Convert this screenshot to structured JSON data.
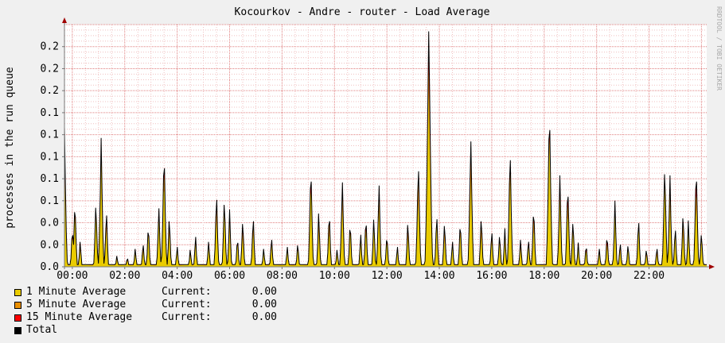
{
  "chart_data": {
    "type": "area",
    "title": "Kocourkov - Andre - router - Load Average",
    "ylabel": "processes in the run queue",
    "xlabel": "",
    "watermark": "RRDTOOL / TOBI OETIKER",
    "x_ticks": [
      "00:00",
      "02:00",
      "04:00",
      "06:00",
      "08:00",
      "10:00",
      "12:00",
      "14:00",
      "16:00",
      "18:00",
      "20:00",
      "22:00"
    ],
    "y_tick_labels": [
      "0.0",
      "0.0",
      "0.0",
      "0.1",
      "0.1",
      "0.1",
      "0.1",
      "0.1",
      "0.2",
      "0.2",
      "0.2"
    ],
    "y_tick_values": [
      0.0,
      0.02,
      0.04,
      0.06,
      0.08,
      0.1,
      0.12,
      0.14,
      0.16,
      0.18,
      0.2
    ],
    "ylim": [
      0,
      0.22
    ],
    "xlim_hours": [
      -0.3,
      24.2
    ],
    "grid": true,
    "colors": {
      "one": "#EACC00",
      "five": "#EA8F00",
      "fifteen": "#FF0000",
      "total": "#000000",
      "grid_minor": "#f0c0c0",
      "grid_major": "#e08080",
      "axis": "#777777",
      "arrow": "#a00000",
      "canvas": "#ffffff"
    },
    "series": [
      {
        "name": "1 Minute Average",
        "current": "0.00"
      },
      {
        "name": "5 Minute Average",
        "current": "0.00"
      },
      {
        "name": "15 Minute Average",
        "current": "0.00"
      },
      {
        "name": "Total"
      }
    ],
    "current_label": "Current:",
    "peaks": [
      [
        -0.3,
        0.127
      ],
      [
        0.0,
        0.039
      ],
      [
        0.1,
        0.065
      ],
      [
        0.3,
        0.025
      ],
      [
        0.9,
        0.064
      ],
      [
        1.1,
        0.117
      ],
      [
        1.3,
        0.056
      ],
      [
        1.7,
        0.011
      ],
      [
        2.1,
        0.01
      ],
      [
        2.4,
        0.018
      ],
      [
        2.7,
        0.024
      ],
      [
        2.9,
        0.042
      ],
      [
        3.3,
        0.058
      ],
      [
        3.5,
        0.112
      ],
      [
        3.7,
        0.05
      ],
      [
        4.0,
        0.02
      ],
      [
        4.5,
        0.017
      ],
      [
        4.7,
        0.03
      ],
      [
        5.2,
        0.025
      ],
      [
        5.5,
        0.072
      ],
      [
        5.8,
        0.067
      ],
      [
        6.0,
        0.052
      ],
      [
        6.3,
        0.03
      ],
      [
        6.5,
        0.047
      ],
      [
        6.9,
        0.05
      ],
      [
        7.3,
        0.018
      ],
      [
        7.6,
        0.03
      ],
      [
        8.2,
        0.02
      ],
      [
        8.6,
        0.024
      ],
      [
        9.1,
        0.098
      ],
      [
        9.4,
        0.053
      ],
      [
        9.8,
        0.055
      ],
      [
        10.1,
        0.017
      ],
      [
        10.3,
        0.083
      ],
      [
        10.6,
        0.045
      ],
      [
        11.0,
        0.032
      ],
      [
        11.2,
        0.05
      ],
      [
        11.5,
        0.047
      ],
      [
        11.7,
        0.08
      ],
      [
        12.0,
        0.033
      ],
      [
        12.4,
        0.02
      ],
      [
        12.8,
        0.046
      ],
      [
        13.2,
        0.101
      ],
      [
        13.6,
        0.225
      ],
      [
        13.9,
        0.052
      ],
      [
        14.2,
        0.045
      ],
      [
        14.5,
        0.025
      ],
      [
        14.8,
        0.046
      ],
      [
        15.2,
        0.122
      ],
      [
        15.6,
        0.05
      ],
      [
        16.0,
        0.037
      ],
      [
        16.3,
        0.033
      ],
      [
        16.5,
        0.035
      ],
      [
        16.7,
        0.112
      ],
      [
        17.1,
        0.027
      ],
      [
        17.4,
        0.028
      ],
      [
        17.6,
        0.06
      ],
      [
        18.2,
        0.151
      ],
      [
        18.6,
        0.083
      ],
      [
        18.9,
        0.082
      ],
      [
        19.1,
        0.047
      ],
      [
        19.3,
        0.022
      ],
      [
        19.6,
        0.023
      ],
      [
        20.1,
        0.018
      ],
      [
        20.4,
        0.033
      ],
      [
        20.7,
        0.06
      ],
      [
        20.9,
        0.025
      ],
      [
        21.2,
        0.023
      ],
      [
        21.6,
        0.048
      ],
      [
        21.9,
        0.018
      ],
      [
        22.3,
        0.02
      ],
      [
        22.6,
        0.098
      ],
      [
        22.8,
        0.083
      ],
      [
        23.0,
        0.04
      ],
      [
        23.3,
        0.053
      ],
      [
        23.5,
        0.042
      ],
      [
        23.8,
        0.098
      ],
      [
        24.0,
        0.035
      ]
    ]
  }
}
